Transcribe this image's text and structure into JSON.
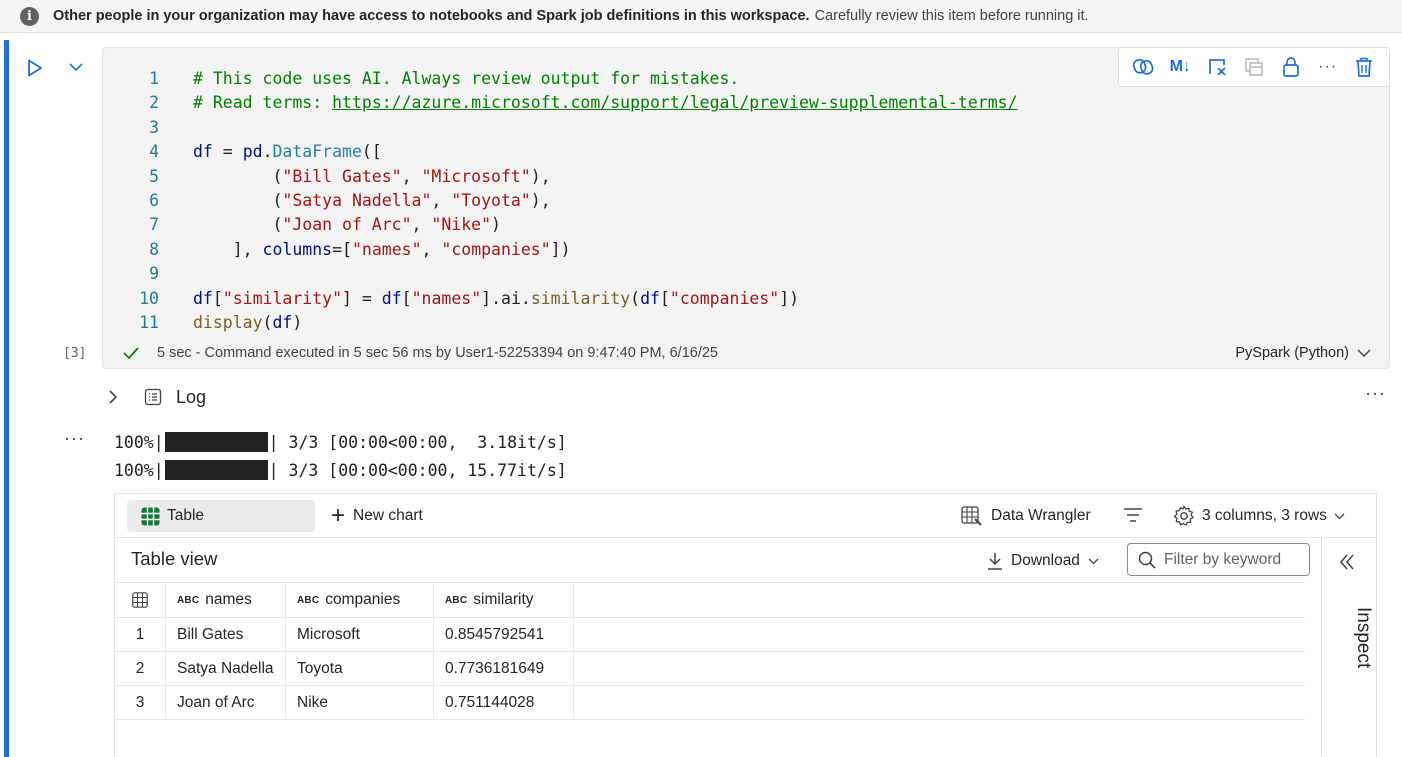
{
  "banner": {
    "strong_text": "Other people in your organization may have access to notebooks and Spark job definitions in this workspace.",
    "rest_text": "Carefully review this item before running it."
  },
  "cell": {
    "execution_count": "[3]",
    "toolbar": {
      "markdown_label": "M↓"
    },
    "code_lines": [
      {
        "n": "1"
      },
      {
        "n": "2"
      },
      {
        "n": "3"
      },
      {
        "n": "4"
      },
      {
        "n": "5"
      },
      {
        "n": "6"
      },
      {
        "n": "7"
      },
      {
        "n": "8"
      },
      {
        "n": "9"
      },
      {
        "n": "10"
      },
      {
        "n": "11"
      }
    ],
    "code": {
      "l1": "# This code uses AI. Always review output for mistakes.",
      "l2_prefix": "# Read terms: ",
      "l2_link": "https://azure.microsoft.com/support/legal/preview-supplemental-terms/",
      "l4_df": "df",
      "l4_eq": " = ",
      "l4_pd": "pd",
      "l4_dot": ".",
      "l4_cls": "DataFrame",
      "l4_open": "([",
      "l5_indent": "        (",
      "l5_s1": "\"Bill Gates\"",
      "l5_comma": ", ",
      "l5_s2": "\"Microsoft\"",
      "l5_close": "),",
      "l6_indent": "        (",
      "l6_s1": "\"Satya Nadella\"",
      "l6_comma": ", ",
      "l6_s2": "\"Toyota\"",
      "l6_close": "),",
      "l7_indent": "        (",
      "l7_s1": "\"Joan of Arc\"",
      "l7_comma": ", ",
      "l7_s2": "\"Nike\"",
      "l7_close": ")",
      "l8_pre": "    ], ",
      "l8_kw": "columns",
      "l8_eq": "=[",
      "l8_s1": "\"names\"",
      "l8_comma": ", ",
      "l8_s2": "\"companies\"",
      "l8_close": "])",
      "l10_df": "df",
      "l10_b1": "[",
      "l10_s1": "\"similarity\"",
      "l10_b2": "] = ",
      "l10_df2": "df",
      "l10_b3": "[",
      "l10_s2": "\"names\"",
      "l10_b4": "].ai.",
      "l10_fn": "similarity",
      "l10_p": "(",
      "l10_df3": "df",
      "l10_b5": "[",
      "l10_s3": "\"companies\"",
      "l10_end": "])",
      "l11_fn": "display",
      "l11_p": "(",
      "l11_df": "df",
      "l11_end": ")"
    },
    "status_text": "5 sec - Command executed in 5 sec 56 ms by User1-52253394 on 9:47:40 PM, 6/16/25",
    "language": "PySpark (Python)"
  },
  "output": {
    "log_label": "Log",
    "more": "···",
    "progress": [
      {
        "pct": "100%|",
        "rest": "| 3/3 [00:00<00:00,  3.18it/s]"
      },
      {
        "pct": "100%|",
        "rest": "| 3/3 [00:00<00:00, 15.77it/s]"
      }
    ]
  },
  "table_panel": {
    "tab_table": "Table",
    "new_chart": "New chart",
    "data_wrangler": "Data Wrangler",
    "col_rows": "3 columns, 3 rows",
    "title": "Table view",
    "download": "Download",
    "filter_placeholder": "Filter by keyword",
    "inspect": "Inspect",
    "type_badge": "ABC",
    "columns": [
      "names",
      "companies",
      "similarity"
    ],
    "rows": [
      {
        "idx": "1",
        "names": "Bill Gates",
        "companies": "Microsoft",
        "similarity": "0.8545792541"
      },
      {
        "idx": "2",
        "names": "Satya Nadella",
        "companies": "Toyota",
        "similarity": "0.7736181649"
      },
      {
        "idx": "3",
        "names": "Joan of Arc",
        "companies": "Nike",
        "similarity": "0.751144028"
      }
    ]
  },
  "colors": {
    "accent": "#1e6fd6",
    "success": "#107c10",
    "comment": "#008000",
    "string": "#a31515"
  }
}
